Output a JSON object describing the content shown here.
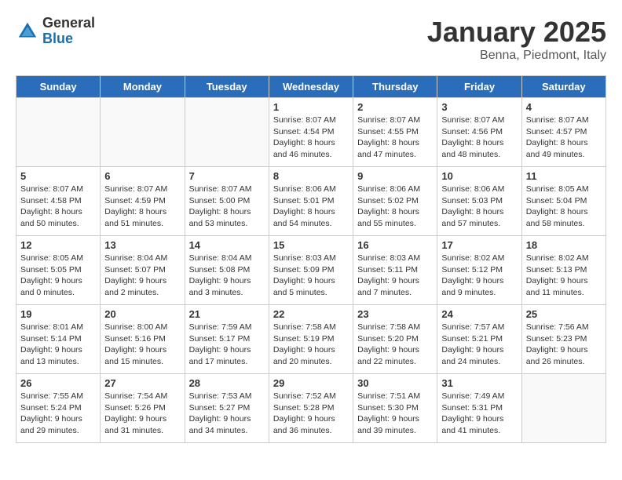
{
  "header": {
    "logo_general": "General",
    "logo_blue": "Blue",
    "month_year": "January 2025",
    "location": "Benna, Piedmont, Italy"
  },
  "weekdays": [
    "Sunday",
    "Monday",
    "Tuesday",
    "Wednesday",
    "Thursday",
    "Friday",
    "Saturday"
  ],
  "weeks": [
    [
      {
        "day": "",
        "info": ""
      },
      {
        "day": "",
        "info": ""
      },
      {
        "day": "",
        "info": ""
      },
      {
        "day": "1",
        "info": "Sunrise: 8:07 AM\nSunset: 4:54 PM\nDaylight: 8 hours and 46 minutes."
      },
      {
        "day": "2",
        "info": "Sunrise: 8:07 AM\nSunset: 4:55 PM\nDaylight: 8 hours and 47 minutes."
      },
      {
        "day": "3",
        "info": "Sunrise: 8:07 AM\nSunset: 4:56 PM\nDaylight: 8 hours and 48 minutes."
      },
      {
        "day": "4",
        "info": "Sunrise: 8:07 AM\nSunset: 4:57 PM\nDaylight: 8 hours and 49 minutes."
      }
    ],
    [
      {
        "day": "5",
        "info": "Sunrise: 8:07 AM\nSunset: 4:58 PM\nDaylight: 8 hours and 50 minutes."
      },
      {
        "day": "6",
        "info": "Sunrise: 8:07 AM\nSunset: 4:59 PM\nDaylight: 8 hours and 51 minutes."
      },
      {
        "day": "7",
        "info": "Sunrise: 8:07 AM\nSunset: 5:00 PM\nDaylight: 8 hours and 53 minutes."
      },
      {
        "day": "8",
        "info": "Sunrise: 8:06 AM\nSunset: 5:01 PM\nDaylight: 8 hours and 54 minutes."
      },
      {
        "day": "9",
        "info": "Sunrise: 8:06 AM\nSunset: 5:02 PM\nDaylight: 8 hours and 55 minutes."
      },
      {
        "day": "10",
        "info": "Sunrise: 8:06 AM\nSunset: 5:03 PM\nDaylight: 8 hours and 57 minutes."
      },
      {
        "day": "11",
        "info": "Sunrise: 8:05 AM\nSunset: 5:04 PM\nDaylight: 8 hours and 58 minutes."
      }
    ],
    [
      {
        "day": "12",
        "info": "Sunrise: 8:05 AM\nSunset: 5:05 PM\nDaylight: 9 hours and 0 minutes."
      },
      {
        "day": "13",
        "info": "Sunrise: 8:04 AM\nSunset: 5:07 PM\nDaylight: 9 hours and 2 minutes."
      },
      {
        "day": "14",
        "info": "Sunrise: 8:04 AM\nSunset: 5:08 PM\nDaylight: 9 hours and 3 minutes."
      },
      {
        "day": "15",
        "info": "Sunrise: 8:03 AM\nSunset: 5:09 PM\nDaylight: 9 hours and 5 minutes."
      },
      {
        "day": "16",
        "info": "Sunrise: 8:03 AM\nSunset: 5:11 PM\nDaylight: 9 hours and 7 minutes."
      },
      {
        "day": "17",
        "info": "Sunrise: 8:02 AM\nSunset: 5:12 PM\nDaylight: 9 hours and 9 minutes."
      },
      {
        "day": "18",
        "info": "Sunrise: 8:02 AM\nSunset: 5:13 PM\nDaylight: 9 hours and 11 minutes."
      }
    ],
    [
      {
        "day": "19",
        "info": "Sunrise: 8:01 AM\nSunset: 5:14 PM\nDaylight: 9 hours and 13 minutes."
      },
      {
        "day": "20",
        "info": "Sunrise: 8:00 AM\nSunset: 5:16 PM\nDaylight: 9 hours and 15 minutes."
      },
      {
        "day": "21",
        "info": "Sunrise: 7:59 AM\nSunset: 5:17 PM\nDaylight: 9 hours and 17 minutes."
      },
      {
        "day": "22",
        "info": "Sunrise: 7:58 AM\nSunset: 5:19 PM\nDaylight: 9 hours and 20 minutes."
      },
      {
        "day": "23",
        "info": "Sunrise: 7:58 AM\nSunset: 5:20 PM\nDaylight: 9 hours and 22 minutes."
      },
      {
        "day": "24",
        "info": "Sunrise: 7:57 AM\nSunset: 5:21 PM\nDaylight: 9 hours and 24 minutes."
      },
      {
        "day": "25",
        "info": "Sunrise: 7:56 AM\nSunset: 5:23 PM\nDaylight: 9 hours and 26 minutes."
      }
    ],
    [
      {
        "day": "26",
        "info": "Sunrise: 7:55 AM\nSunset: 5:24 PM\nDaylight: 9 hours and 29 minutes."
      },
      {
        "day": "27",
        "info": "Sunrise: 7:54 AM\nSunset: 5:26 PM\nDaylight: 9 hours and 31 minutes."
      },
      {
        "day": "28",
        "info": "Sunrise: 7:53 AM\nSunset: 5:27 PM\nDaylight: 9 hours and 34 minutes."
      },
      {
        "day": "29",
        "info": "Sunrise: 7:52 AM\nSunset: 5:28 PM\nDaylight: 9 hours and 36 minutes."
      },
      {
        "day": "30",
        "info": "Sunrise: 7:51 AM\nSunset: 5:30 PM\nDaylight: 9 hours and 39 minutes."
      },
      {
        "day": "31",
        "info": "Sunrise: 7:49 AM\nSunset: 5:31 PM\nDaylight: 9 hours and 41 minutes."
      },
      {
        "day": "",
        "info": ""
      }
    ]
  ]
}
